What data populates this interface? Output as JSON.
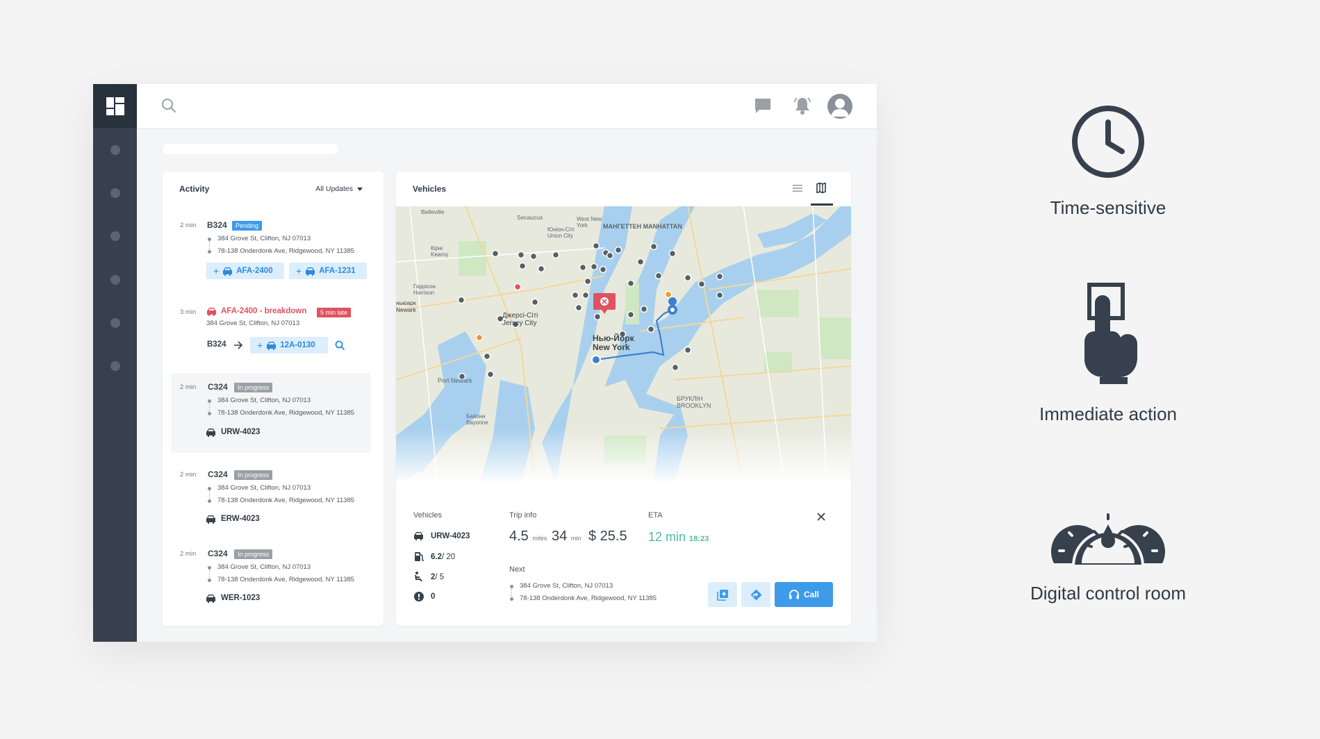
{
  "activity": {
    "title": "Activity",
    "filter": "All Updates",
    "items": [
      {
        "time": "2 min",
        "id": "B324",
        "badge": "Pending",
        "from": "384 Grove St, Clifton, NJ 07013",
        "to": "78-138 Onderdonk Ave, Ridgewood, NY 11385",
        "chips": [
          "AFA-2400",
          "AFA-1231"
        ]
      },
      {
        "time": "3 min",
        "title": "AFA-2400 - breakdown",
        "badge": "5 min late",
        "address": "384 Grove St, Clifton, NJ 07013",
        "from_id": "B324",
        "chip": "12A-0130"
      },
      {
        "time": "2 min",
        "id": "C324",
        "badge": "In progress",
        "from": "384 Grove St, Clifton, NJ 07013",
        "to": "78-138 Onderdonk Ave, Ridgewood, NY 11385",
        "vehicle": "URW-4023"
      },
      {
        "time": "2 min",
        "id": "C324",
        "badge": "In progress",
        "from": "384 Grove St, Clifton, NJ 07013",
        "to": "78-138 Onderdonk Ave, Ridgewood, NY 11385",
        "vehicle": "ERW-4023"
      },
      {
        "time": "2 min",
        "id": "C324",
        "badge": "In progress",
        "from": "384 Grove St, Clifton, NJ 07013",
        "to": "78-138 Onderdonk Ave, Ridgewood, NY 11385",
        "vehicle": "WER-1023"
      }
    ]
  },
  "vehicles": {
    "title": "Vehicles",
    "map_labels": {
      "manhattan": "МАНГЕТТЕН MANHATTAN",
      "jersey": "Джерсі-Сіті Jersey City",
      "ny_ru": "Нью-Йорк",
      "ny_en": "New York",
      "brooklyn": "БРУКЛІН BROOKLYN",
      "port_newark": "Port Newark",
      "belleville": "Belleville",
      "union_city": "Юніон-Сіті Union City",
      "west_ny": "West New York",
      "newark": "ньюарк Newark",
      "harrison": "Гаррісон Harrison",
      "kearny": "Кірні Kearny",
      "secaucus": "Secaucus",
      "bayonne": "Байонн Bayonne"
    },
    "panel": {
      "vehicles_label": "Vehicles",
      "vehicle_id": "URW-4023",
      "fuel": "6.2",
      "fuel_total": "/ 20",
      "seats": "2",
      "seats_total": "/ 5",
      "alerts": "0",
      "trip_label": "Trip info",
      "miles": "4.5",
      "miles_unit": "miles",
      "minutes": "34",
      "minutes_unit": "min",
      "price": "$ 25.5",
      "eta_label": "ETA",
      "eta_value": "12 min",
      "eta_time": "18:23",
      "next_label": "Next",
      "next_from": "384 Grove St, Clifton, NJ 07013",
      "next_to": "78-138 Onderdonk Ave, Ridgewood, NY 11385",
      "call_label": "Call"
    }
  },
  "features": [
    {
      "label": "Time-sensitive",
      "icon": "clock-icon"
    },
    {
      "label": "Immediate action",
      "icon": "hand-pointer-icon"
    },
    {
      "label": "Digital control room",
      "icon": "dashboard-gauges-icon"
    }
  ],
  "colors": {
    "sidebar": "#36414d",
    "accent_blue": "#3d9be9",
    "alert_red": "#e0525f",
    "eta_green": "#4bbf9c",
    "status_grey": "#9aa0a6"
  }
}
